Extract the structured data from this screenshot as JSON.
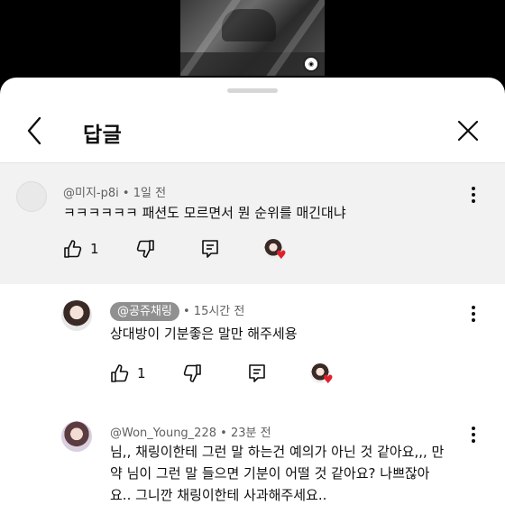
{
  "sheet": {
    "title": "답글"
  },
  "comments": [
    {
      "author": "@미지-p8i",
      "time": "1일 전",
      "text": "ㅋㅋㅋㅋㅋㅋ 패션도 모르면서 뭔 순위를 매긴대냐",
      "likes": "1"
    },
    {
      "author": "@공쥬채링",
      "time": "15시간 전",
      "text": "상대방이 기분좋은 말만 해주세용",
      "likes": "1"
    },
    {
      "author": "@Won_Young_228",
      "time": "23분 전",
      "text_lines": [
        "님,, 채링이한테 그런 말 하는건 예의가 아닌 것 같아요,,, 만",
        "약 님이 그런 말 들으면 기분이 어떨 것 같아요? 나쁘잖아",
        "요.. 그니깐 채링이한테 사과해주세요.."
      ]
    }
  ],
  "separator": "•",
  "icons": {
    "back": "chevron-left-icon",
    "close": "close-icon",
    "like": "thumbs-up-icon",
    "dislike": "thumbs-down-icon",
    "reply": "reply-icon",
    "more": "more-vertical-icon",
    "heart": "creator-heart-icon"
  },
  "colors": {
    "heart": "#e0202c",
    "highlight_bg": "#f2f2f2",
    "chip_bg": "#909090"
  }
}
